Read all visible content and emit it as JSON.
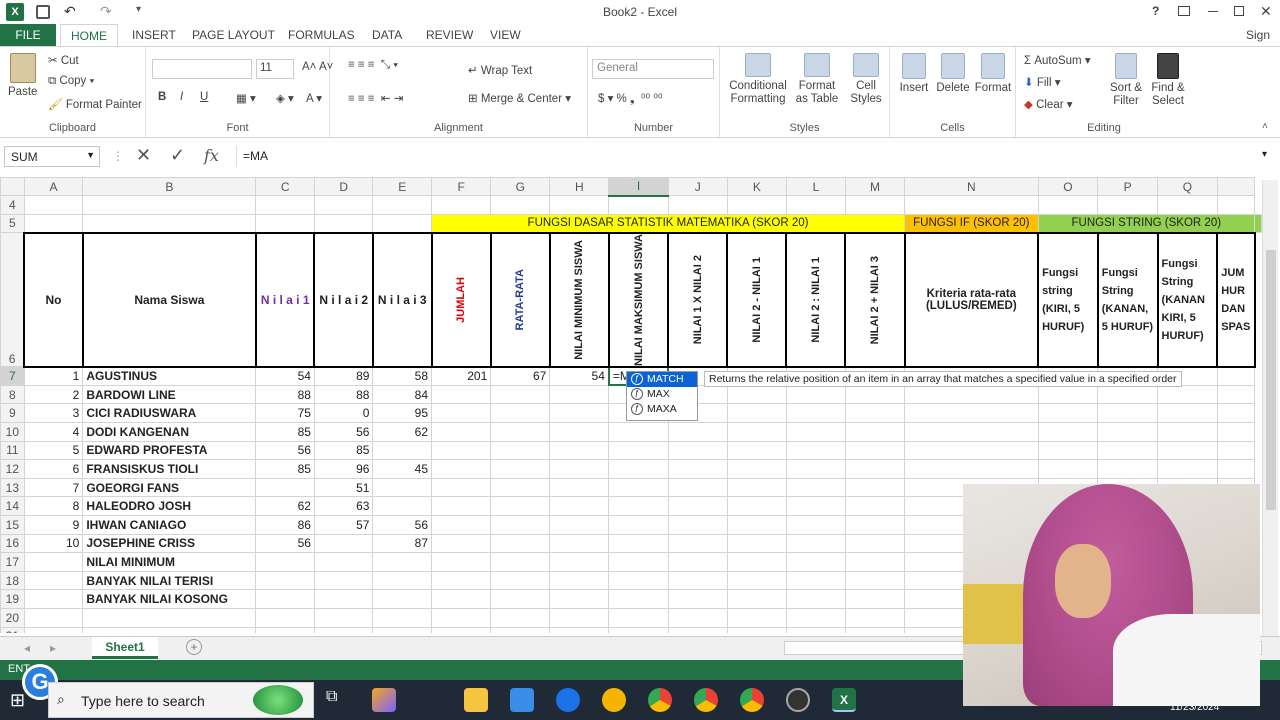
{
  "window": {
    "title": "Book2 - Excel",
    "signin": "Sign in"
  },
  "tabs": [
    "FILE",
    "HOME",
    "INSERT",
    "PAGE LAYOUT",
    "FORMULAS",
    "DATA",
    "REVIEW",
    "VIEW"
  ],
  "ribbon": {
    "clipboard": {
      "paste": "Paste",
      "cut": "Cut",
      "copy": "Copy",
      "format_painter": "Format Painter",
      "label": "Clipboard"
    },
    "font": {
      "size": "11",
      "label": "Font",
      "bold": "B",
      "italic": "I",
      "underline": "U"
    },
    "alignment": {
      "wrap": "Wrap Text",
      "merge": "Merge & Center",
      "label": "Alignment"
    },
    "number": {
      "format": "General",
      "label": "Number"
    },
    "styles": {
      "conditional": "Conditional Formatting",
      "format_table": "Format as Table",
      "cell_styles": "Cell Styles",
      "label": "Styles"
    },
    "cells": {
      "insert": "Insert",
      "delete": "Delete",
      "format": "Format",
      "label": "Cells"
    },
    "editing": {
      "autosum": "AutoSum",
      "fill": "Fill",
      "clear": "Clear",
      "sort": "Sort & Filter",
      "find": "Find & Select",
      "label": "Editing"
    }
  },
  "formula_bar": {
    "name_box": "SUM",
    "formula": "=MA"
  },
  "columns": [
    "A",
    "B",
    "C",
    "D",
    "E",
    "F",
    "G",
    "H",
    "I",
    "J",
    "K",
    "L",
    "M",
    "N",
    "O",
    "P",
    "Q"
  ],
  "headers": {
    "band1": "FUNGSI DASAR STATISTIK MATEMATIKA (SKOR 20)",
    "band2": "FUNGSI IF (SKOR 20)",
    "band3": "FUNGSI STRING (SKOR 20)",
    "no": "No",
    "nama": "Nama Siswa",
    "nilai1": "N i l a i  1",
    "nilai2": "N i l a i  2",
    "nilai3": "N i l a i  3",
    "jumlah": "JUMLAH",
    "rata": "RATA-RATA",
    "min": "NILAI MINIMUM SISWA",
    "max": "NILAI MAKSIMUM SISWA",
    "j": "NILAI 1 X NILAI 2",
    "k": "NILAI 2 - NILAI 1",
    "l": "NILAI 2 : NILAI 1",
    "m": "NILAI 2 + NILAI 3",
    "n": "Kriteria rata-rata (LULUS/REMED)",
    "o": "Fungsi string (KIRI, 5 HURUF)",
    "p": "Fungsi String (KANAN, 5 HURUF)",
    "q": "Fungsi String (KANAN KIRI, 5 HURUF)",
    "r": "JUM HUR DAN SPAS"
  },
  "rows": [
    {
      "r": "7",
      "no": "1",
      "name": "AGUSTINUS",
      "c": "54",
      "d": "89",
      "e": "58",
      "f": "201",
      "g": "67",
      "h": "54",
      "i": "=MA"
    },
    {
      "r": "8",
      "no": "2",
      "name": "BARDOWI LINE",
      "c": "88",
      "d": "88",
      "e": "84"
    },
    {
      "r": "9",
      "no": "3",
      "name": "CICI RADIUSWARA",
      "c": "75",
      "d": "0",
      "e": "95"
    },
    {
      "r": "10",
      "no": "4",
      "name": "DODI KANGENAN",
      "c": "85",
      "d": "56",
      "e": "62"
    },
    {
      "r": "11",
      "no": "5",
      "name": "EDWARD PROFESTA",
      "c": "56",
      "d": "85",
      "e": ""
    },
    {
      "r": "12",
      "no": "6",
      "name": "FRANSISKUS TIOLI",
      "c": "85",
      "d": "96",
      "e": "45"
    },
    {
      "r": "13",
      "no": "7",
      "name": "GOEORGI FANS",
      "c": "",
      "d": "51",
      "e": ""
    },
    {
      "r": "14",
      "no": "8",
      "name": "HALEODRO JOSH",
      "c": "62",
      "d": "63",
      "e": ""
    },
    {
      "r": "15",
      "no": "9",
      "name": "IHWAN CANIAGO",
      "c": "86",
      "d": "57",
      "e": "56"
    },
    {
      "r": "16",
      "no": "10",
      "name": "JOSEPHINE CRISS",
      "c": "56",
      "d": "",
      "e": "87"
    },
    {
      "r": "17",
      "no": "",
      "name": "NILAI MINIMUM",
      "c": "",
      "d": "",
      "e": ""
    },
    {
      "r": "18",
      "no": "",
      "name": "BANYAK NILAI TERISI",
      "c": "",
      "d": "",
      "e": ""
    },
    {
      "r": "19",
      "no": "",
      "name": "BANYAK NILAI KOSONG",
      "c": "",
      "d": "",
      "e": ""
    }
  ],
  "autocomplete": {
    "items": [
      "MATCH",
      "MAX",
      "MAXA"
    ],
    "tooltip": "Returns the relative position of an item in an array that matches a specified value in a specified order"
  },
  "sheet": {
    "tab": "Sheet1"
  },
  "status": {
    "mode": "ENT"
  },
  "taskbar": {
    "search": "Type here to search",
    "date": "11/23/2024"
  },
  "colors": {
    "excel_green": "#217346",
    "yellow": "#ffff00",
    "orange": "#ffc000",
    "green": "#92d050"
  }
}
